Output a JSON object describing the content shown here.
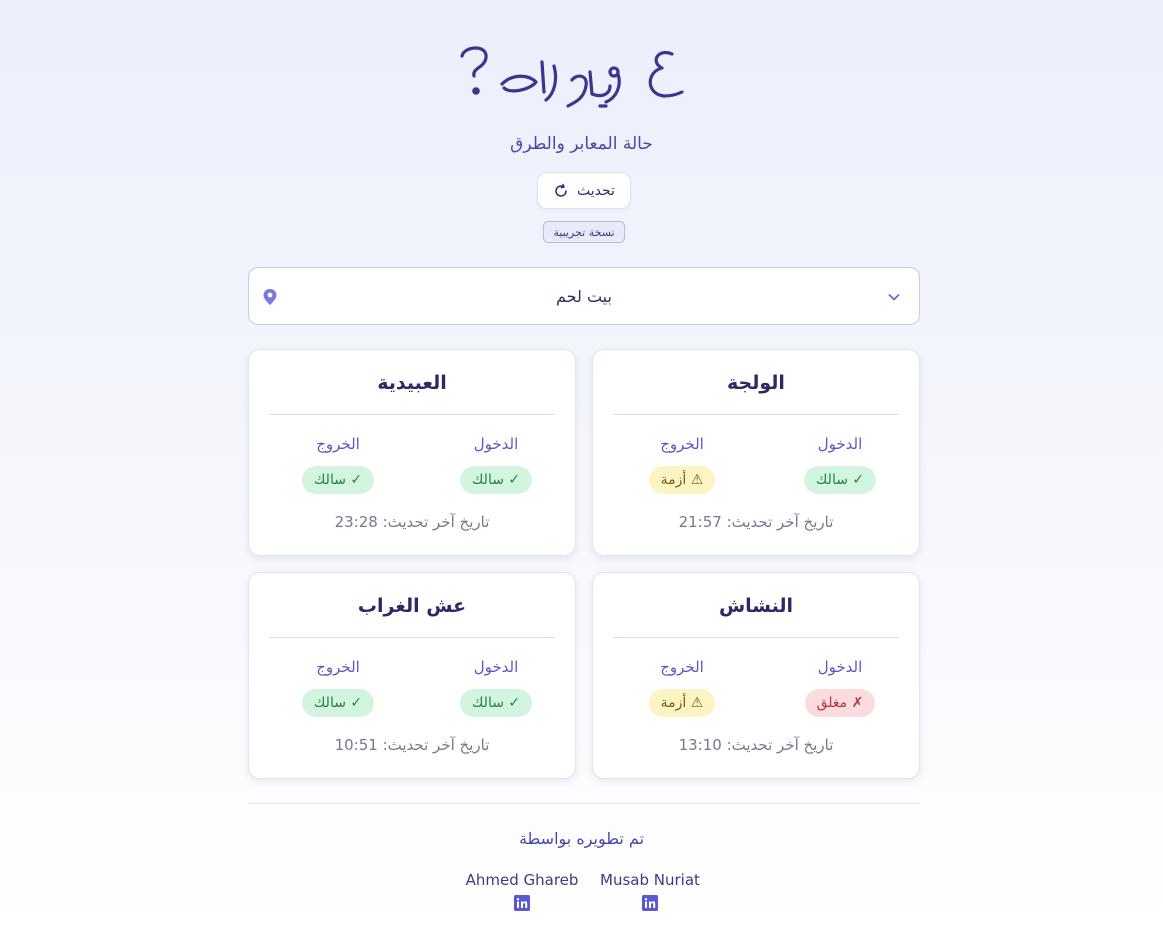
{
  "header": {
    "logo_text": "ع وين رايح ؟",
    "subtitle": "حالة المعابر والطرق",
    "refresh_label": "تحديث",
    "beta_label": "نسخة تجريبية"
  },
  "city_select": {
    "value": "بيت لحم"
  },
  "labels": {
    "entry": "الدخول",
    "exit": "الخروج",
    "updated_prefix": "تاريخ آخر تحديث:"
  },
  "checkpoints": [
    {
      "name": "الولجة",
      "entry": "سالك ✓",
      "entry_status": "open",
      "exit": "أزمة ⚠",
      "exit_status": "crisis",
      "updated": "تاريخ آخر تحديث: 21:57"
    },
    {
      "name": "العبيدية",
      "entry": "سالك ✓",
      "entry_status": "open",
      "exit": "سالك ✓",
      "exit_status": "open",
      "updated": "تاريخ آخر تحديث: 23:28"
    },
    {
      "name": "النشاش",
      "entry": "مغلق ✗",
      "entry_status": "closed",
      "exit": "أزمة ⚠",
      "exit_status": "crisis",
      "updated": "تاريخ آخر تحديث: 13:10"
    },
    {
      "name": "عش الغراب",
      "entry": "سالك ✓",
      "entry_status": "open",
      "exit": "سالك ✓",
      "exit_status": "open",
      "updated": "تاريخ آخر تحديث: 10:51"
    }
  ],
  "footer": {
    "title": "تم تطويره بواسطة",
    "developers": [
      {
        "name": "Musab Nuriat",
        "icon": "linkedin-icon"
      },
      {
        "name": "Ahmed Ghareb",
        "icon": "linkedin-icon"
      }
    ]
  },
  "colors": {
    "accent": "#5b58d0",
    "open_bg": "#d3f5df",
    "crisis_bg": "#fcf4c3",
    "closed_bg": "#fbdcde"
  }
}
